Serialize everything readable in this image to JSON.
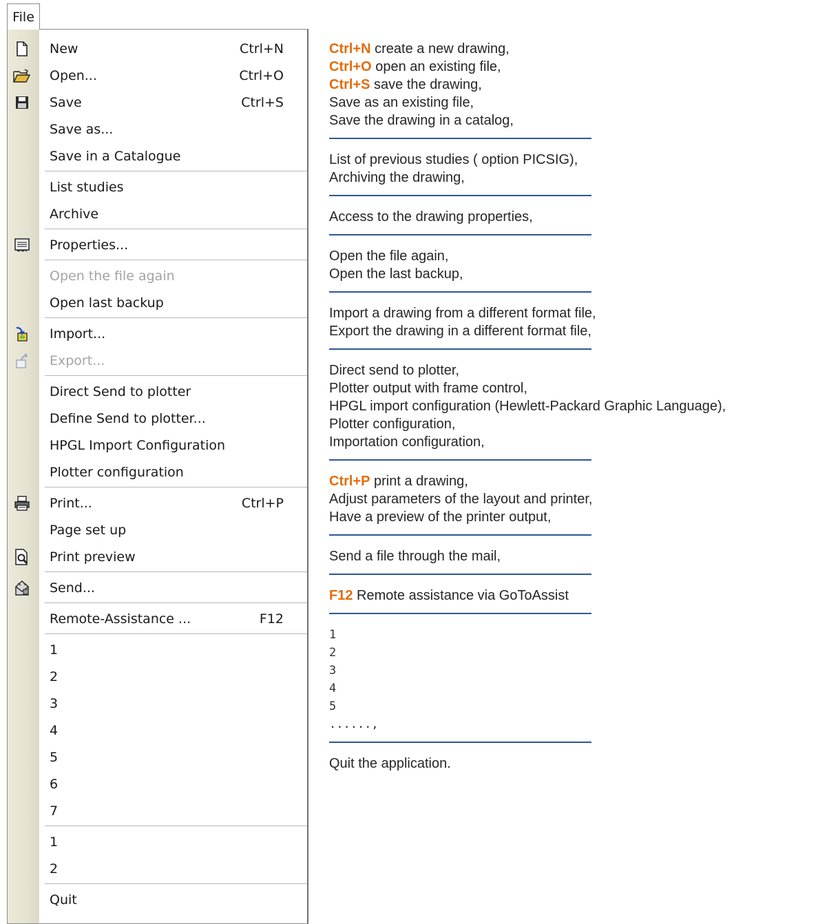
{
  "menu": {
    "title": "File",
    "items": [
      {
        "label": "New",
        "shortcut": "Ctrl+N",
        "icon": "new-document-icon"
      },
      {
        "label": "Open...",
        "shortcut": "Ctrl+O",
        "icon": "open-folder-icon"
      },
      {
        "label": "Save",
        "shortcut": "Ctrl+S",
        "icon": "floppy-disk-icon"
      },
      {
        "label": "Save as..."
      },
      {
        "label": "Save in a Catalogue"
      },
      {
        "label": "List studies"
      },
      {
        "label": "Archive"
      },
      {
        "label": "Properties...",
        "icon": "properties-icon"
      },
      {
        "label": "Open the file again",
        "disabled": true
      },
      {
        "label": "Open last backup"
      },
      {
        "label": "Import...",
        "icon": "import-icon"
      },
      {
        "label": "Export...",
        "icon": "export-icon",
        "disabled": true
      },
      {
        "label": "Direct Send to plotter"
      },
      {
        "label": "Define Send to plotter..."
      },
      {
        "label": "HPGL Import Configuration"
      },
      {
        "label": "Plotter configuration"
      },
      {
        "label": "Print...",
        "shortcut": "Ctrl+P",
        "icon": "printer-icon"
      },
      {
        "label": "Page set up"
      },
      {
        "label": "Print preview",
        "icon": "print-preview-icon"
      },
      {
        "label": "Send...",
        "icon": "send-mail-icon"
      },
      {
        "label": "Remote-Assistance ...",
        "shortcut": "F12"
      },
      {
        "label": "1"
      },
      {
        "label": "2"
      },
      {
        "label": "3"
      },
      {
        "label": "4"
      },
      {
        "label": "5"
      },
      {
        "label": "6"
      },
      {
        "label": "7"
      },
      {
        "label": "1"
      },
      {
        "label": "2"
      },
      {
        "label": "Quit"
      }
    ],
    "separators_after": [
      4,
      6,
      7,
      9,
      11,
      15,
      18,
      19,
      20,
      27,
      29
    ]
  },
  "descriptions": [
    {
      "lines": [
        {
          "key": "Ctrl+N",
          "text": " create a new drawing,"
        },
        {
          "key": "Ctrl+O",
          "text": " open an existing file,"
        },
        {
          "key": "Ctrl+S",
          "text": " save the drawing,"
        },
        {
          "text": "Save as an existing file,"
        },
        {
          "text": "Save the drawing in a catalog,"
        }
      ]
    },
    {
      "lines": [
        {
          "text": "List of previous studies ( option PICSIG),"
        },
        {
          "text": "Archiving the drawing,"
        }
      ]
    },
    {
      "lines": [
        {
          "text": "Access to the drawing properties,"
        }
      ]
    },
    {
      "lines": [
        {
          "text": "Open the file again,"
        },
        {
          "text": "Open the last backup,"
        }
      ]
    },
    {
      "lines": [
        {
          "text": "Import a drawing from a different format file,"
        },
        {
          "text": "Export the drawing in a different format file,"
        }
      ]
    },
    {
      "lines": [
        {
          "text": "Direct send to plotter,"
        },
        {
          "text": "Plotter output with frame control,"
        },
        {
          "text": "HPGL import configuration (Hewlett-Packard Graphic Language),"
        },
        {
          "text": "Plotter configuration,"
        },
        {
          "text": "Importation configuration,"
        }
      ]
    },
    {
      "lines": [
        {
          "key": "Ctrl+P",
          "text": " print a drawing,"
        },
        {
          "text": "Adjust parameters of the layout and printer,"
        },
        {
          "text": "Have a preview of the printer output,"
        }
      ]
    },
    {
      "lines": [
        {
          "text": "Send a file through the mail,"
        }
      ]
    },
    {
      "lines": [
        {
          "key": "F12",
          "text": " Remote assistance via GoToAssist"
        }
      ]
    },
    {
      "lines": [
        {
          "text": "1",
          "mono": true
        },
        {
          "text": "2",
          "mono": true
        },
        {
          "text": "3",
          "mono": true
        },
        {
          "text": "4",
          "mono": true
        },
        {
          "text": "5",
          "mono": true
        },
        {
          "text": "......,",
          "mono": true
        }
      ]
    },
    {
      "lines": [
        {
          "text": "Quit the application."
        }
      ]
    }
  ],
  "colors": {
    "key_highlight": "#e36c0a",
    "rule": "#2f5597",
    "disabled_text": "#a4a4a4"
  }
}
